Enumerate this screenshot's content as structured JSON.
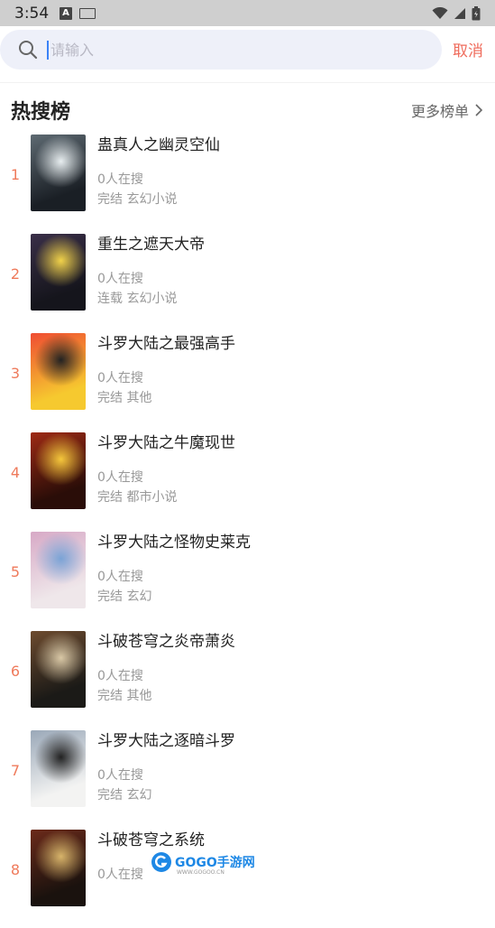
{
  "status_bar": {
    "time": "3:54",
    "icons": [
      "a-icon",
      "keyboard-icon",
      "wifi-icon",
      "signal-icon",
      "battery-icon"
    ]
  },
  "search": {
    "placeholder": "请输入",
    "value": "",
    "cancel_label": "取消"
  },
  "hot": {
    "title": "热搜榜",
    "more_label": "更多榜单"
  },
  "books": [
    {
      "rank": "1",
      "title": "蛊真人之幽灵空仙",
      "heat": "0人在搜",
      "meta": "完结 玄幻小说",
      "cover_palette": [
        "#1a1f25",
        "#5e6a72",
        "#e8eef0"
      ]
    },
    {
      "rank": "2",
      "title": "重生之遮天大帝",
      "heat": "0人在搜",
      "meta": "连载 玄幻小说",
      "cover_palette": [
        "#15151c",
        "#3a2f48",
        "#f1d24a"
      ]
    },
    {
      "rank": "3",
      "title": "斗罗大陆之最强高手",
      "heat": "0人在搜",
      "meta": "完结 其他",
      "cover_palette": [
        "#f6c92f",
        "#ef4c32",
        "#222222"
      ]
    },
    {
      "rank": "4",
      "title": "斗罗大陆之牛魔现世",
      "heat": "0人在搜",
      "meta": "完结 都市小说",
      "cover_palette": [
        "#2a0d08",
        "#9e2a14",
        "#f5c73c"
      ]
    },
    {
      "rank": "5",
      "title": "斗罗大陆之怪物史莱克",
      "heat": "0人在搜",
      "meta": "完结 玄幻",
      "cover_palette": [
        "#efe7ea",
        "#d7a9c6",
        "#7aa3d6"
      ]
    },
    {
      "rank": "6",
      "title": "斗破苍穹之炎帝萧炎",
      "heat": "0人在搜",
      "meta": "完结 其他",
      "cover_palette": [
        "#1b1a17",
        "#6d4b2f",
        "#d9c8a6"
      ]
    },
    {
      "rank": "7",
      "title": "斗罗大陆之逐暗斗罗",
      "heat": "0人在搜",
      "meta": "完结 玄幻",
      "cover_palette": [
        "#f3f3f2",
        "#9aa8b8",
        "#222222"
      ]
    },
    {
      "rank": "8",
      "title": "斗破苍穹之系统",
      "heat": "0人在搜",
      "meta": "",
      "cover_palette": [
        "#1a120e",
        "#6b2a1a",
        "#d7b46a"
      ]
    }
  ],
  "watermark": {
    "text": "GOGO手游网",
    "url": "WWW.GOGOO.CN"
  }
}
